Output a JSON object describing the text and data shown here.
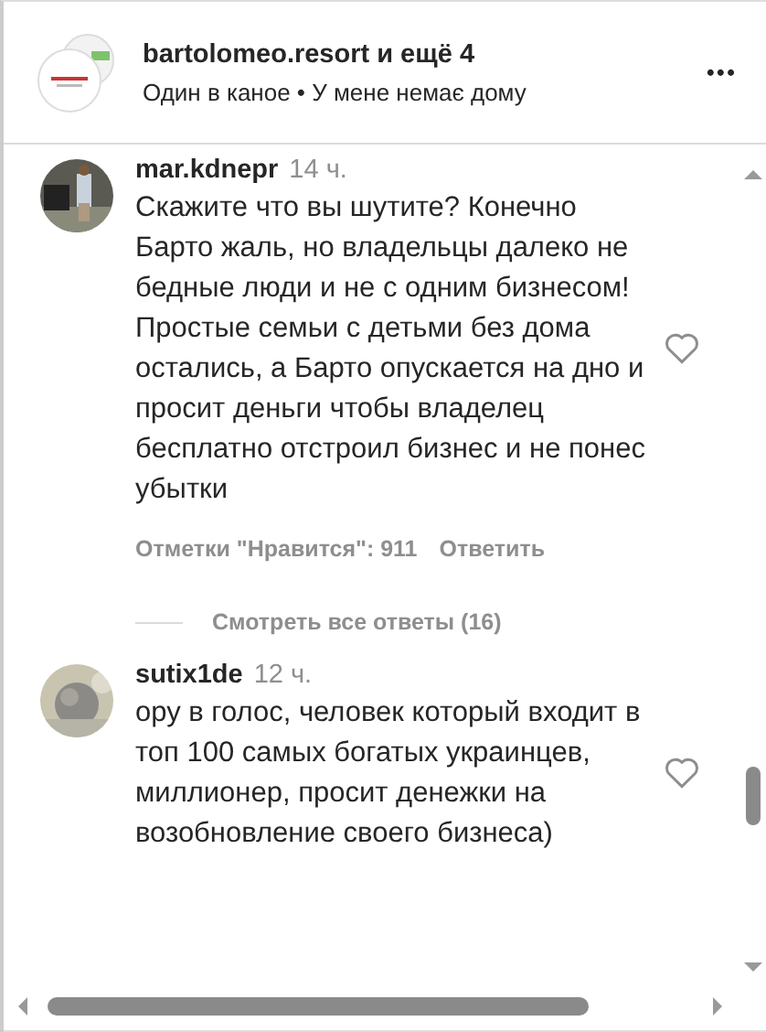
{
  "header": {
    "title": "bartolomeo.resort и ещё 4",
    "subtitle": "Один в каное • У мене немає дому",
    "more": "•••"
  },
  "comments": [
    {
      "user": "mar.kdnepr",
      "time": "14 ч.",
      "text": "Скажите что вы шутите? Конечно Барто жаль, но владельцы далеко не бедные люди и не с одним бизнесом! Простые семьи с детьми без дома остались, а Барто опускается на дно и просит деньги чтобы владелец бесплатно отстроил бизнес и не понес убытки",
      "likes": "Отметки \"Нравится\": 911",
      "reply": "Ответить",
      "view_replies": "Смотреть все ответы (16)"
    },
    {
      "user": "sutix1de",
      "time": "12 ч.",
      "text": "ору в голос, человек который входит в топ 100 самых богатых украинцев, миллионер, просит денежки на возобновление своего бизнеса)"
    }
  ]
}
